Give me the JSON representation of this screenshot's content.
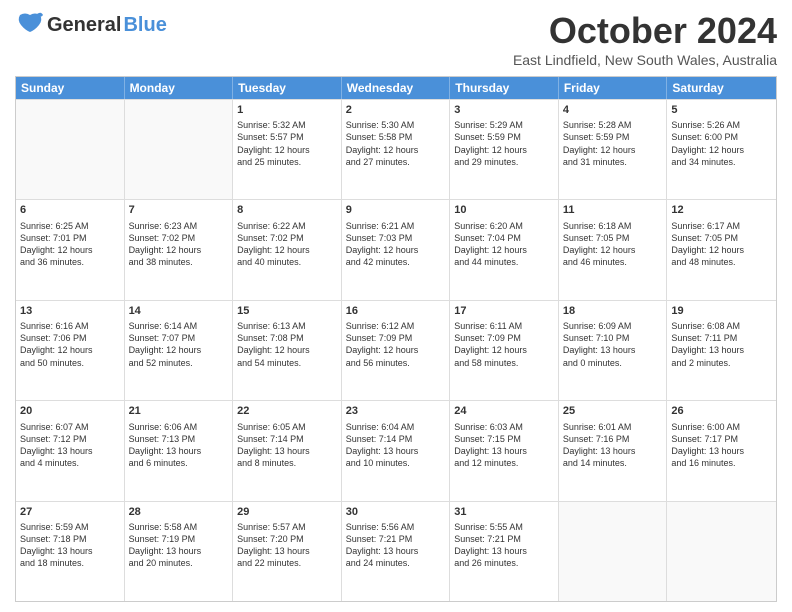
{
  "header": {
    "logo_general": "General",
    "logo_blue": "Blue",
    "month_title": "October 2024",
    "location": "East Lindfield, New South Wales, Australia"
  },
  "days_of_week": [
    "Sunday",
    "Monday",
    "Tuesday",
    "Wednesday",
    "Thursday",
    "Friday",
    "Saturday"
  ],
  "weeks": [
    [
      {
        "day": "",
        "empty": true,
        "content": ""
      },
      {
        "day": "",
        "empty": true,
        "content": ""
      },
      {
        "day": "1",
        "empty": false,
        "content": "Sunrise: 5:32 AM\nSunset: 5:57 PM\nDaylight: 12 hours\nand 25 minutes."
      },
      {
        "day": "2",
        "empty": false,
        "content": "Sunrise: 5:30 AM\nSunset: 5:58 PM\nDaylight: 12 hours\nand 27 minutes."
      },
      {
        "day": "3",
        "empty": false,
        "content": "Sunrise: 5:29 AM\nSunset: 5:59 PM\nDaylight: 12 hours\nand 29 minutes."
      },
      {
        "day": "4",
        "empty": false,
        "content": "Sunrise: 5:28 AM\nSunset: 5:59 PM\nDaylight: 12 hours\nand 31 minutes."
      },
      {
        "day": "5",
        "empty": false,
        "content": "Sunrise: 5:26 AM\nSunset: 6:00 PM\nDaylight: 12 hours\nand 34 minutes."
      }
    ],
    [
      {
        "day": "6",
        "empty": false,
        "content": "Sunrise: 6:25 AM\nSunset: 7:01 PM\nDaylight: 12 hours\nand 36 minutes."
      },
      {
        "day": "7",
        "empty": false,
        "content": "Sunrise: 6:23 AM\nSunset: 7:02 PM\nDaylight: 12 hours\nand 38 minutes."
      },
      {
        "day": "8",
        "empty": false,
        "content": "Sunrise: 6:22 AM\nSunset: 7:02 PM\nDaylight: 12 hours\nand 40 minutes."
      },
      {
        "day": "9",
        "empty": false,
        "content": "Sunrise: 6:21 AM\nSunset: 7:03 PM\nDaylight: 12 hours\nand 42 minutes."
      },
      {
        "day": "10",
        "empty": false,
        "content": "Sunrise: 6:20 AM\nSunset: 7:04 PM\nDaylight: 12 hours\nand 44 minutes."
      },
      {
        "day": "11",
        "empty": false,
        "content": "Sunrise: 6:18 AM\nSunset: 7:05 PM\nDaylight: 12 hours\nand 46 minutes."
      },
      {
        "day": "12",
        "empty": false,
        "content": "Sunrise: 6:17 AM\nSunset: 7:05 PM\nDaylight: 12 hours\nand 48 minutes."
      }
    ],
    [
      {
        "day": "13",
        "empty": false,
        "content": "Sunrise: 6:16 AM\nSunset: 7:06 PM\nDaylight: 12 hours\nand 50 minutes."
      },
      {
        "day": "14",
        "empty": false,
        "content": "Sunrise: 6:14 AM\nSunset: 7:07 PM\nDaylight: 12 hours\nand 52 minutes."
      },
      {
        "day": "15",
        "empty": false,
        "content": "Sunrise: 6:13 AM\nSunset: 7:08 PM\nDaylight: 12 hours\nand 54 minutes."
      },
      {
        "day": "16",
        "empty": false,
        "content": "Sunrise: 6:12 AM\nSunset: 7:09 PM\nDaylight: 12 hours\nand 56 minutes."
      },
      {
        "day": "17",
        "empty": false,
        "content": "Sunrise: 6:11 AM\nSunset: 7:09 PM\nDaylight: 12 hours\nand 58 minutes."
      },
      {
        "day": "18",
        "empty": false,
        "content": "Sunrise: 6:09 AM\nSunset: 7:10 PM\nDaylight: 13 hours\nand 0 minutes."
      },
      {
        "day": "19",
        "empty": false,
        "content": "Sunrise: 6:08 AM\nSunset: 7:11 PM\nDaylight: 13 hours\nand 2 minutes."
      }
    ],
    [
      {
        "day": "20",
        "empty": false,
        "content": "Sunrise: 6:07 AM\nSunset: 7:12 PM\nDaylight: 13 hours\nand 4 minutes."
      },
      {
        "day": "21",
        "empty": false,
        "content": "Sunrise: 6:06 AM\nSunset: 7:13 PM\nDaylight: 13 hours\nand 6 minutes."
      },
      {
        "day": "22",
        "empty": false,
        "content": "Sunrise: 6:05 AM\nSunset: 7:14 PM\nDaylight: 13 hours\nand 8 minutes."
      },
      {
        "day": "23",
        "empty": false,
        "content": "Sunrise: 6:04 AM\nSunset: 7:14 PM\nDaylight: 13 hours\nand 10 minutes."
      },
      {
        "day": "24",
        "empty": false,
        "content": "Sunrise: 6:03 AM\nSunset: 7:15 PM\nDaylight: 13 hours\nand 12 minutes."
      },
      {
        "day": "25",
        "empty": false,
        "content": "Sunrise: 6:01 AM\nSunset: 7:16 PM\nDaylight: 13 hours\nand 14 minutes."
      },
      {
        "day": "26",
        "empty": false,
        "content": "Sunrise: 6:00 AM\nSunset: 7:17 PM\nDaylight: 13 hours\nand 16 minutes."
      }
    ],
    [
      {
        "day": "27",
        "empty": false,
        "content": "Sunrise: 5:59 AM\nSunset: 7:18 PM\nDaylight: 13 hours\nand 18 minutes."
      },
      {
        "day": "28",
        "empty": false,
        "content": "Sunrise: 5:58 AM\nSunset: 7:19 PM\nDaylight: 13 hours\nand 20 minutes."
      },
      {
        "day": "29",
        "empty": false,
        "content": "Sunrise: 5:57 AM\nSunset: 7:20 PM\nDaylight: 13 hours\nand 22 minutes."
      },
      {
        "day": "30",
        "empty": false,
        "content": "Sunrise: 5:56 AM\nSunset: 7:21 PM\nDaylight: 13 hours\nand 24 minutes."
      },
      {
        "day": "31",
        "empty": false,
        "content": "Sunrise: 5:55 AM\nSunset: 7:21 PM\nDaylight: 13 hours\nand 26 minutes."
      },
      {
        "day": "",
        "empty": true,
        "content": ""
      },
      {
        "day": "",
        "empty": true,
        "content": ""
      }
    ]
  ]
}
